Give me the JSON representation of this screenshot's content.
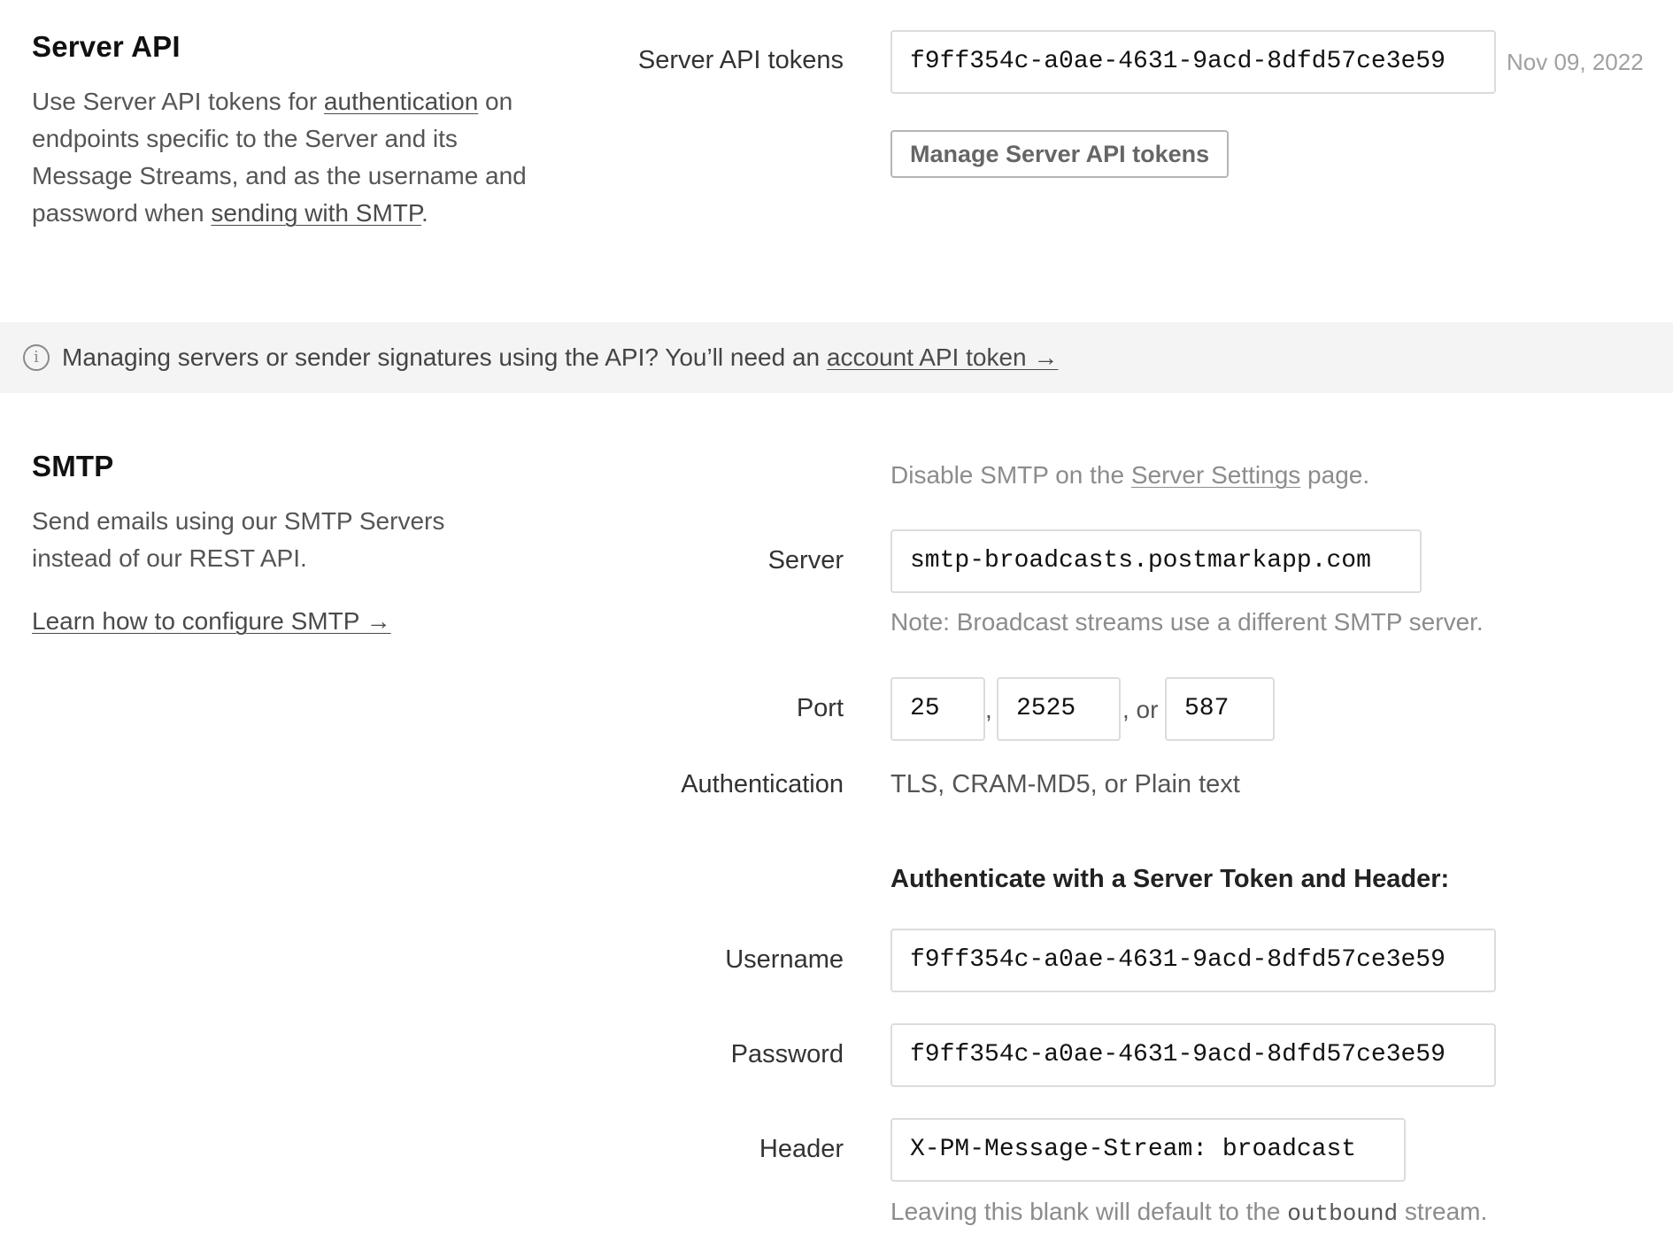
{
  "server_api": {
    "title": "Server API",
    "desc_part1": "Use Server API tokens for ",
    "desc_link1": "authentication",
    "desc_part2": " on endpoints specific to the Server and its Message Streams, and as the username and password when ",
    "desc_link2": "sending with SMTP",
    "desc_part3": ".",
    "tokens_label": "Server API tokens",
    "token_value": "f9ff354c-a0ae-4631-9acd-8dfd57ce3e59",
    "token_date": "Nov 09, 2022",
    "manage_button": "Manage Server API tokens"
  },
  "info_bar": {
    "icon": "info-icon",
    "icon_glyph": "i",
    "text": "Managing servers or sender signatures using the API? You’ll need an ",
    "link": "account API token →"
  },
  "smtp": {
    "title": "SMTP",
    "description": "Send emails using our SMTP Servers instead of our REST API.",
    "learn_link": "Learn how to configure SMTP →",
    "disable_part1": "Disable SMTP on the ",
    "disable_link": "Server Settings",
    "disable_part2": " page.",
    "server_label": "Server",
    "server_value": "smtp-broadcasts.postmarkapp.com",
    "server_note": "Note: Broadcast streams use a different SMTP server.",
    "port_label": "Port",
    "ports": [
      "25",
      "2525",
      "587"
    ],
    "port_sep1": ",",
    "port_sep2": ", or",
    "auth_label": "Authentication",
    "auth_value": "TLS, CRAM-MD5, or Plain text",
    "auth_heading": "Authenticate with a Server Token and Header:",
    "username_label": "Username",
    "username_value": "f9ff354c-a0ae-4631-9acd-8dfd57ce3e59",
    "password_label": "Password",
    "password_value": "f9ff354c-a0ae-4631-9acd-8dfd57ce3e59",
    "header_label": "Header",
    "header_value": "X-PM-Message-Stream: broadcast",
    "header_note_part1": "Leaving this blank will default to the ",
    "header_note_code": "outbound",
    "header_note_part2": " stream."
  }
}
